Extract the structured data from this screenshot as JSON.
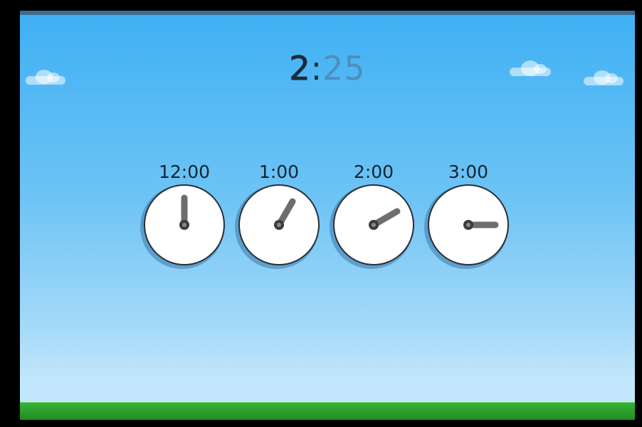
{
  "time_display": {
    "hour": "2",
    "colon": ":",
    "minutes": "25"
  },
  "clocks": [
    {
      "label": "12:00",
      "hour_angle": 0
    },
    {
      "label": "1:00",
      "hour_angle": 30
    },
    {
      "label": "2:00",
      "hour_angle": 60
    },
    {
      "label": "3:00",
      "hour_angle": 90
    }
  ],
  "colors": {
    "sky_top": "#3fb0f3",
    "sky_bottom": "#c2e6fb",
    "grass": "#2ea12c",
    "hand": "#6e6e6e",
    "minutes_text": "#4d8fbd"
  }
}
